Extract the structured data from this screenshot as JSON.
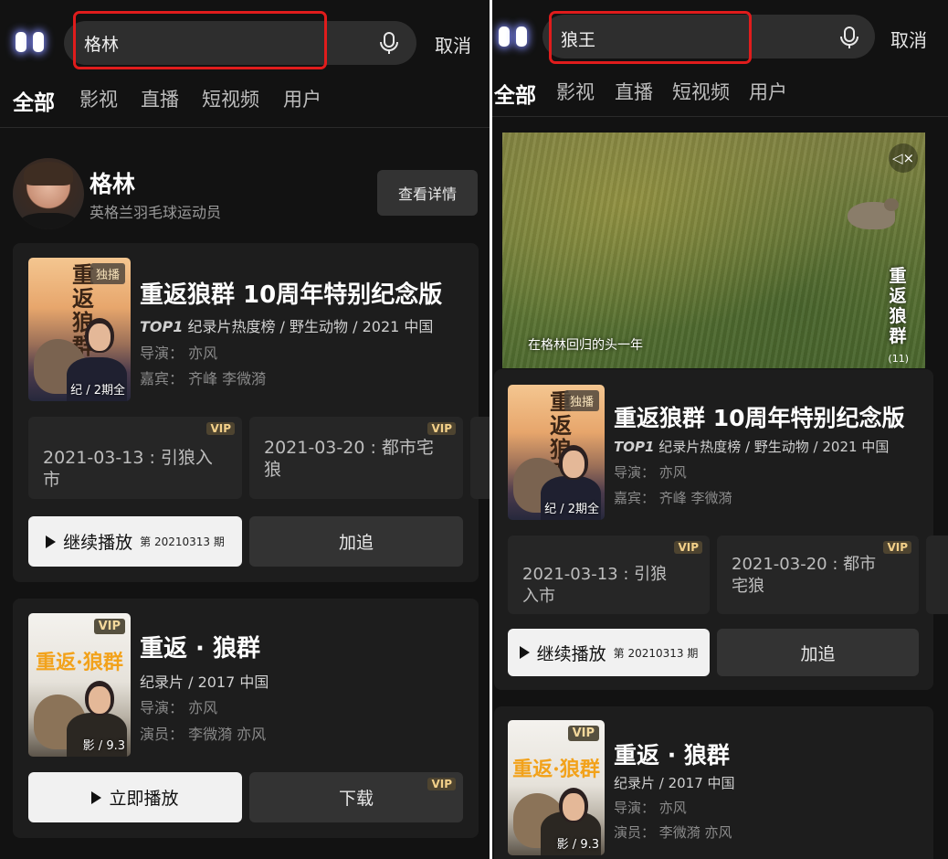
{
  "left": {
    "search": {
      "query": "格林",
      "cancel": "取消"
    },
    "tabs": [
      "全部",
      "影视",
      "直播",
      "短视频",
      "用户"
    ],
    "person": {
      "name": "格林",
      "desc": "英格兰羽毛球运动员",
      "button": "查看详情"
    },
    "card1": {
      "title": "重返狼群 10周年特别纪念版",
      "poster_badge": "独播",
      "poster_calli": "重返狼群",
      "poster_corner": "纪 / 2期全",
      "meta_em": "TOP1",
      "meta": " 纪录片热度榜 / 野生动物 / 2021 中国",
      "director": "导演： 亦风",
      "guests": "嘉宾： 齐峰  李微漪",
      "episodes": [
        {
          "label": "2021-03-13 : 引狼入市",
          "vip": "VIP"
        },
        {
          "label": "2021-03-20 : 都市宅狼",
          "vip": "VIP"
        }
      ],
      "play": {
        "label": "继续播放",
        "sub": "第 20210313 期"
      },
      "follow": "加追"
    },
    "card2": {
      "title": "重返 · 狼群",
      "poster_badge": "VIP",
      "poster_calli": "重返·狼群",
      "poster_corner": "影 / 9.3",
      "meta": "纪录片 / 2017 中国",
      "director": "导演： 亦风",
      "cast": "演员： 李微漪  亦风",
      "play": "立即播放",
      "download": "下载",
      "download_vip": "VIP"
    }
  },
  "right": {
    "search": {
      "query": "狼王",
      "cancel": "取消"
    },
    "tabs": [
      "全部",
      "影视",
      "直播",
      "短视频",
      "用户"
    ],
    "video": {
      "subtitle": "在格林回归的头一年",
      "logo": "重返狼群",
      "num": "(11)",
      "mute_icon": "speaker-mute-icon"
    },
    "card1": {
      "title": "重返狼群 10周年特别纪念版",
      "poster_badge": "独播",
      "poster_calli": "重返狼群",
      "poster_corner": "纪 / 2期全",
      "meta_em": "TOP1",
      "meta": " 纪录片热度榜 / 野生动物 / 2021 中国",
      "director": "导演： 亦风",
      "guests": "嘉宾： 齐峰  李微漪",
      "episodes": [
        {
          "label": "2021-03-13 : 引狼入市",
          "vip": "VIP"
        },
        {
          "label": "2021-03-20 : 都市宅狼",
          "vip": "VIP"
        }
      ],
      "play": {
        "label": "继续播放",
        "sub": "第 20210313 期"
      },
      "follow": "加追"
    },
    "card2": {
      "title": "重返 · 狼群",
      "poster_badge": "VIP",
      "poster_calli": "重返·狼群",
      "poster_corner": "影 / 9.3",
      "meta": "纪录片 / 2017 中国",
      "director": "导演： 亦风",
      "cast": "演员： 李微漪  亦风"
    }
  },
  "colors": {
    "background": "#121212",
    "card": "#1d1d1d",
    "highlight": "#e01c1c",
    "vip_gold": "#f3d089"
  }
}
